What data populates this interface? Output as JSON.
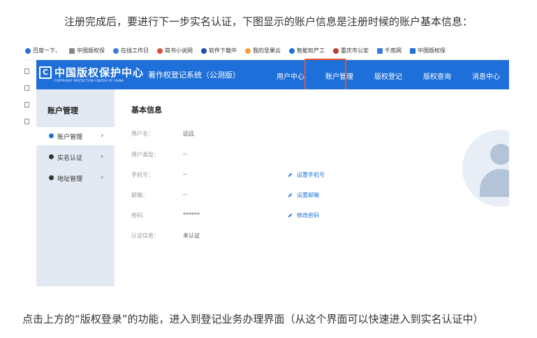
{
  "intro_text": "注册完成后，要进行下一步实名认证，下图显示的账户信息是注册时候的账户基本信息：",
  "outro_text": "点击上方的“版权登录”的功能，进入到登记业务办理界面（从这个界面可以快速进入到实名认证中）",
  "bookmarks": [
    {
      "label": "百度一下、",
      "color": "#2b6de0"
    },
    {
      "label": "中国版权保",
      "color": "#888888"
    },
    {
      "label": "在线工作日",
      "color": "#3a7bd5"
    },
    {
      "label": "简书小说网",
      "color": "#e04b3c"
    },
    {
      "label": "软件下载中",
      "color": "#1e4fa3"
    },
    {
      "label": "我的坚果云",
      "color": "#f0a030"
    },
    {
      "label": "智能知产工",
      "color": "#1e6fd9"
    },
    {
      "label": "重庆市公安",
      "color": "#c0392b"
    },
    {
      "label": "千库网",
      "color": "#3a7bd5"
    },
    {
      "label": "中国版权保",
      "color": "#1e6fd9"
    }
  ],
  "header": {
    "logo_mark": "C",
    "logo_title": "中国版权保护中心",
    "logo_subtitle": "COPYRIGHT PROTECTION CENTER OF CHINA",
    "system_name": "著作权登记系统（公测版）",
    "nav": [
      "用户中心",
      "账户管理",
      "版权登记",
      "版权查询",
      "消息中心"
    ]
  },
  "sidebar": {
    "title": "账户管理",
    "items": [
      "账户管理",
      "实名认证",
      "地址管理"
    ],
    "chevron": "›"
  },
  "content": {
    "title": "基本信息",
    "rows": [
      {
        "label": "用户名：",
        "value": "远远",
        "action": ""
      },
      {
        "label": "用户类型：",
        "value": "--",
        "action": ""
      },
      {
        "label": "手机号：",
        "value": "--",
        "action": "设置手机号"
      },
      {
        "label": "邮箱：",
        "value": "--",
        "action": "设置邮箱"
      },
      {
        "label": "密码：",
        "value": "******",
        "action": "修改密码"
      },
      {
        "label": "认证信息：",
        "value": "未认证",
        "action": ""
      }
    ]
  },
  "colors": {
    "header_blue": "#1e6fd9",
    "highlight_red": "#e8542a",
    "sidebar_bg": "#e3e9f3"
  }
}
